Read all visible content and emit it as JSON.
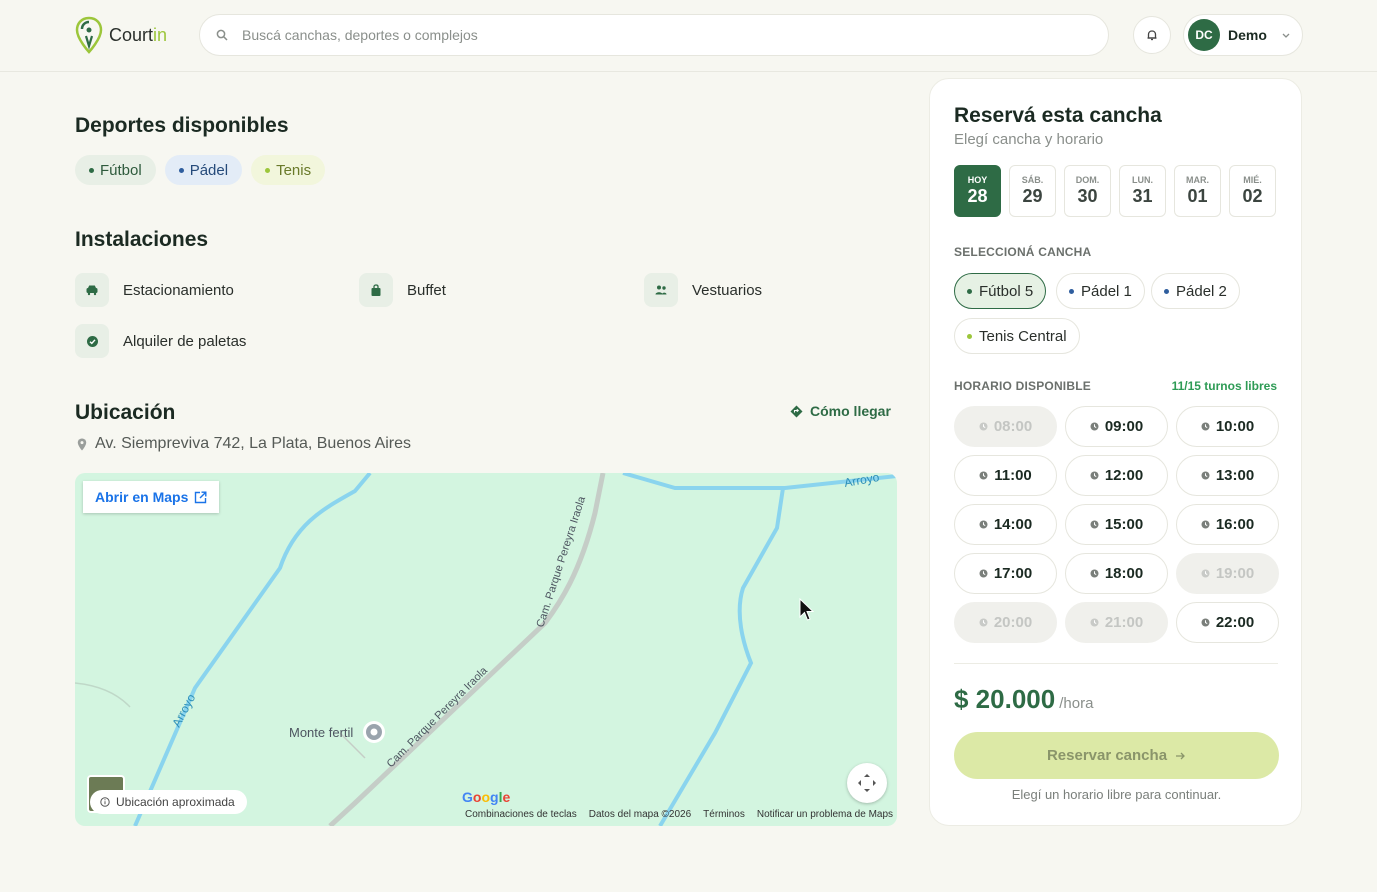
{
  "header": {
    "logo_text_main": "Court",
    "logo_text_accent": "in",
    "search_placeholder": "Buscá canchas, deportes o complejos",
    "user_initials": "DC",
    "user_name": "Demo"
  },
  "sports": {
    "title": "Deportes disponibles",
    "items": [
      {
        "label": "Fútbol",
        "color": "#2e6b45",
        "bg": "#e8efe6",
        "text": "#2e5a3c"
      },
      {
        "label": "Pádel",
        "color": "#2f5e9e",
        "bg": "#e3ecf7",
        "text": "#254a7a"
      },
      {
        "label": "Tenis",
        "color": "#9cc63b",
        "bg": "#f2f6dc",
        "text": "#6a7a2a"
      }
    ]
  },
  "facilities": {
    "title": "Instalaciones",
    "items": [
      {
        "label": "Estacionamiento",
        "icon": "car-icon"
      },
      {
        "label": "Buffet",
        "icon": "bag-icon"
      },
      {
        "label": "Vestuarios",
        "icon": "people-icon"
      },
      {
        "label": "Alquiler de paletas",
        "icon": "check-circle-icon"
      }
    ]
  },
  "location": {
    "title": "Ubicación",
    "directions_label": "Cómo llegar",
    "address": "Av. Siempreviva 742, La Plata, Buenos Aires",
    "map": {
      "open_label": "Abrir en Maps",
      "approx_label": "Ubicación aproximada",
      "place_label": "Monte fertil",
      "road_label_1": "Cam. Parque Pereyra Iraola",
      "road_label_2": "Cam. Parque Pereyra Iraola",
      "stream_label_1": "Arroyo",
      "stream_label_2": "Arroyo",
      "google_label": "Google",
      "footer": [
        "Combinaciones de teclas",
        "Datos del mapa ©2026",
        "Términos",
        "Notificar un problema de Maps"
      ]
    }
  },
  "booking": {
    "title": "Reservá esta cancha",
    "subtitle": "Elegí cancha y horario",
    "days": [
      {
        "weekday": "HOY",
        "num": "28",
        "active": true
      },
      {
        "weekday": "SÁB.",
        "num": "29",
        "active": false
      },
      {
        "weekday": "DOM.",
        "num": "30",
        "active": false
      },
      {
        "weekday": "LUN.",
        "num": "31",
        "active": false
      },
      {
        "weekday": "MAR.",
        "num": "01",
        "active": false
      },
      {
        "weekday": "MIÉ.",
        "num": "02",
        "active": false
      }
    ],
    "court_label": "SELECCIONÁ CANCHA",
    "courts": [
      {
        "label": "Fútbol 5",
        "color": "#2e6b45",
        "active": true
      },
      {
        "label": "Pádel 1",
        "color": "#2f5e9e",
        "active": false
      },
      {
        "label": "Pádel 2",
        "color": "#2f5e9e",
        "active": false
      },
      {
        "label": "Tenis Central",
        "color": "#9cc63b",
        "active": false
      }
    ],
    "schedule_label": "HORARIO DISPONIBLE",
    "free_label": "11/15 turnos libres",
    "slots": [
      {
        "time": "08:00",
        "available": false
      },
      {
        "time": "09:00",
        "available": true
      },
      {
        "time": "10:00",
        "available": true
      },
      {
        "time": "11:00",
        "available": true
      },
      {
        "time": "12:00",
        "available": true
      },
      {
        "time": "13:00",
        "available": true
      },
      {
        "time": "14:00",
        "available": true
      },
      {
        "time": "15:00",
        "available": true
      },
      {
        "time": "16:00",
        "available": true
      },
      {
        "time": "17:00",
        "available": true
      },
      {
        "time": "18:00",
        "available": true
      },
      {
        "time": "19:00",
        "available": false
      },
      {
        "time": "20:00",
        "available": false
      },
      {
        "time": "21:00",
        "available": false
      },
      {
        "time": "22:00",
        "available": true
      }
    ],
    "price": "$ 20.000",
    "price_unit": "/hora",
    "reserve_label": "Reservar cancha",
    "hint": "Elegí un horario libre para continuar."
  }
}
